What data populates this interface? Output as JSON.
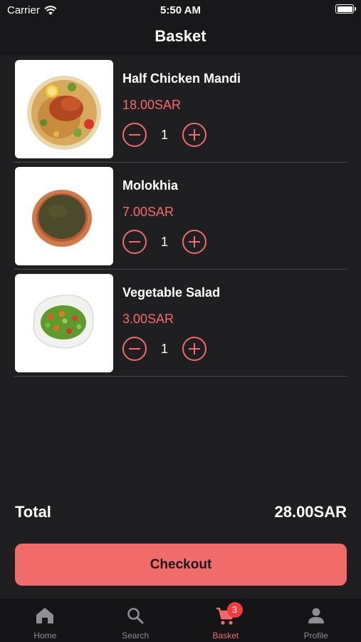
{
  "status_bar": {
    "carrier": "Carrier",
    "time": "5:50 AM"
  },
  "header": {
    "title": "Basket"
  },
  "items": [
    {
      "name": "Half Chicken Mandi",
      "price": "18.00SAR",
      "quantity": "1",
      "image": "chicken-mandi"
    },
    {
      "name": "Molokhia",
      "price": "7.00SAR",
      "quantity": "1",
      "image": "molokhia"
    },
    {
      "name": "Vegetable Salad",
      "price": "3.00SAR",
      "quantity": "1",
      "image": "vegetable-salad"
    }
  ],
  "summary": {
    "total_label": "Total",
    "total_value": "28.00SAR"
  },
  "checkout": {
    "label": "Checkout"
  },
  "tabs": [
    {
      "label": "Home",
      "icon": "home-icon"
    },
    {
      "label": "Search",
      "icon": "search-icon"
    },
    {
      "label": "Basket",
      "icon": "cart-icon",
      "badge": "3",
      "active": true
    },
    {
      "label": "Profile",
      "icon": "person-icon"
    }
  ],
  "colors": {
    "accent": "#f26b6b",
    "background": "#1f1f22",
    "tabbar": "#151517",
    "badge": "#f23b3b"
  }
}
